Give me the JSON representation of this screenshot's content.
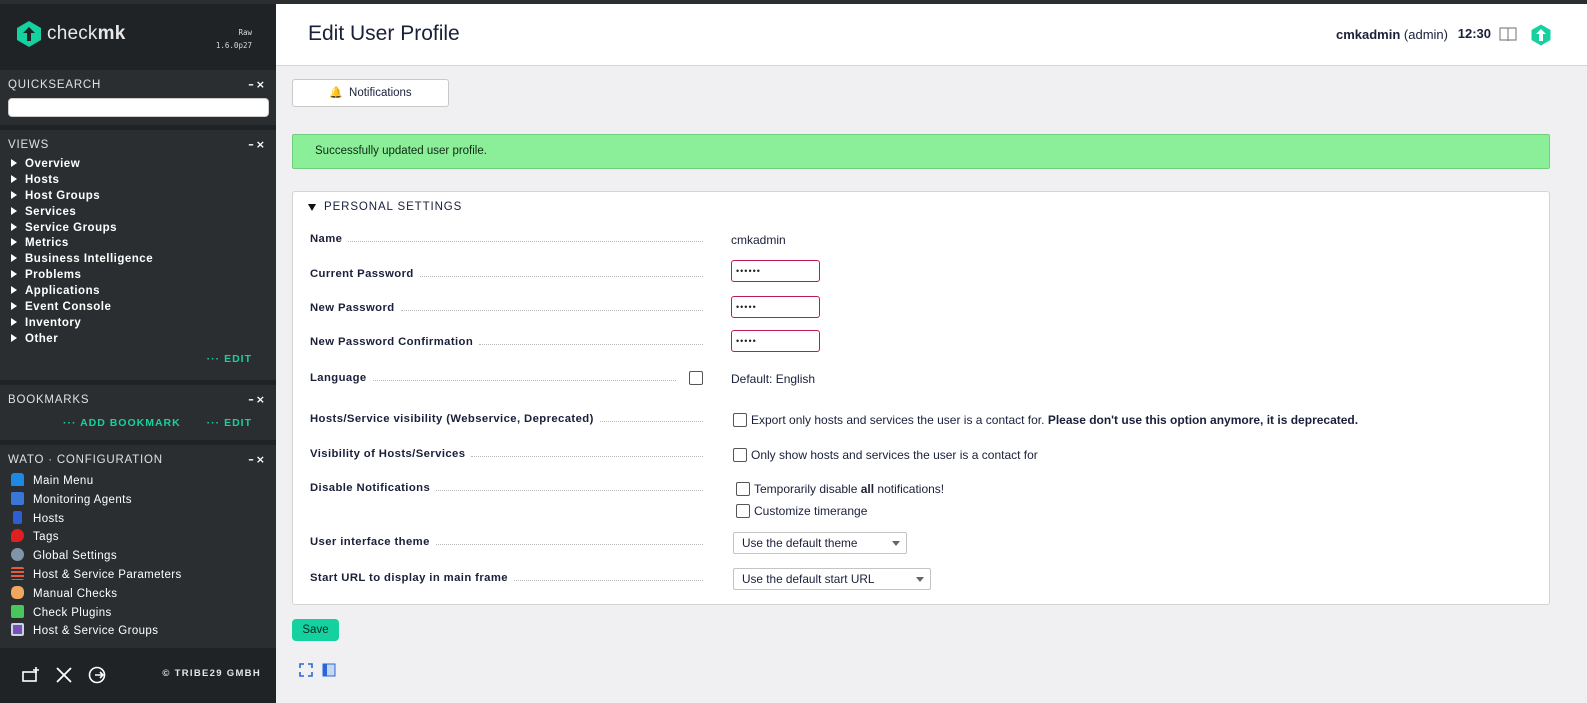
{
  "brand": {
    "name_light": "check",
    "name_bold": "mk",
    "edition": "Raw",
    "version": "1.6.0p27",
    "accent": "#15d1a0"
  },
  "sidebar": {
    "quicksearch": {
      "title": "QUICKSEARCH",
      "value": ""
    },
    "views": {
      "title": "VIEWS",
      "items": [
        "Overview",
        "Hosts",
        "Host Groups",
        "Services",
        "Service Groups",
        "Metrics",
        "Business Intelligence",
        "Problems",
        "Applications",
        "Event Console",
        "Inventory",
        "Other"
      ],
      "edit_label": "EDIT"
    },
    "bookmarks": {
      "title": "BOOKMARKS",
      "add_label": "ADD BOOKMARK",
      "edit_label": "EDIT"
    },
    "wato": {
      "title": "WATO · CONFIGURATION",
      "items": [
        {
          "label": "Main Menu",
          "icon": "main-menu-icon"
        },
        {
          "label": "Monitoring Agents",
          "icon": "agents-icon"
        },
        {
          "label": "Hosts",
          "icon": "hosts-icon"
        },
        {
          "label": "Tags",
          "icon": "tags-icon"
        },
        {
          "label": "Global Settings",
          "icon": "gear-icon"
        },
        {
          "label": "Host & Service Parameters",
          "icon": "rulesets-icon"
        },
        {
          "label": "Manual Checks",
          "icon": "hand-icon"
        },
        {
          "label": "Check Plugins",
          "icon": "plugin-icon"
        },
        {
          "label": "Host & Service Groups",
          "icon": "groups-icon"
        }
      ]
    },
    "footer": {
      "copyright": "© TRIBE29 GMBH"
    }
  },
  "header": {
    "title": "Edit User Profile",
    "user": "cmkadmin",
    "role": "(admin)",
    "time": "12:30"
  },
  "toolbar": {
    "notifications_label": "Notifications"
  },
  "message": {
    "success": "Successfully updated user profile."
  },
  "form": {
    "section_title": "PERSONAL SETTINGS",
    "name": {
      "label": "Name",
      "value": "cmkadmin"
    },
    "current_password": {
      "label": "Current Password",
      "value": "••••••"
    },
    "new_password": {
      "label": "New Password",
      "value": "•••••"
    },
    "new_password_confirm": {
      "label": "New Password Confirmation",
      "value": "•••••"
    },
    "language": {
      "label": "Language",
      "value": "Default: English"
    },
    "visibility_ws": {
      "label": "Hosts/Service visibility (Webservice, Deprecated)",
      "text": "Export only hosts and services the user is a contact for.",
      "warning": "Please don't use this option anymore, it is deprecated."
    },
    "visibility": {
      "label": "Visibility of Hosts/Services",
      "text": "Only show hosts and services the user is a contact for"
    },
    "disable_notifications": {
      "label": "Disable Notifications",
      "text_pre": "Temporarily disable",
      "text_bold": "all",
      "text_post": "notifications!",
      "timerange_label": "Customize timerange"
    },
    "theme": {
      "label": "User interface theme",
      "selected": "Use the default theme"
    },
    "start_url": {
      "label": "Start URL to display in main frame",
      "selected": "Use the default start URL"
    },
    "save_label": "Save"
  }
}
